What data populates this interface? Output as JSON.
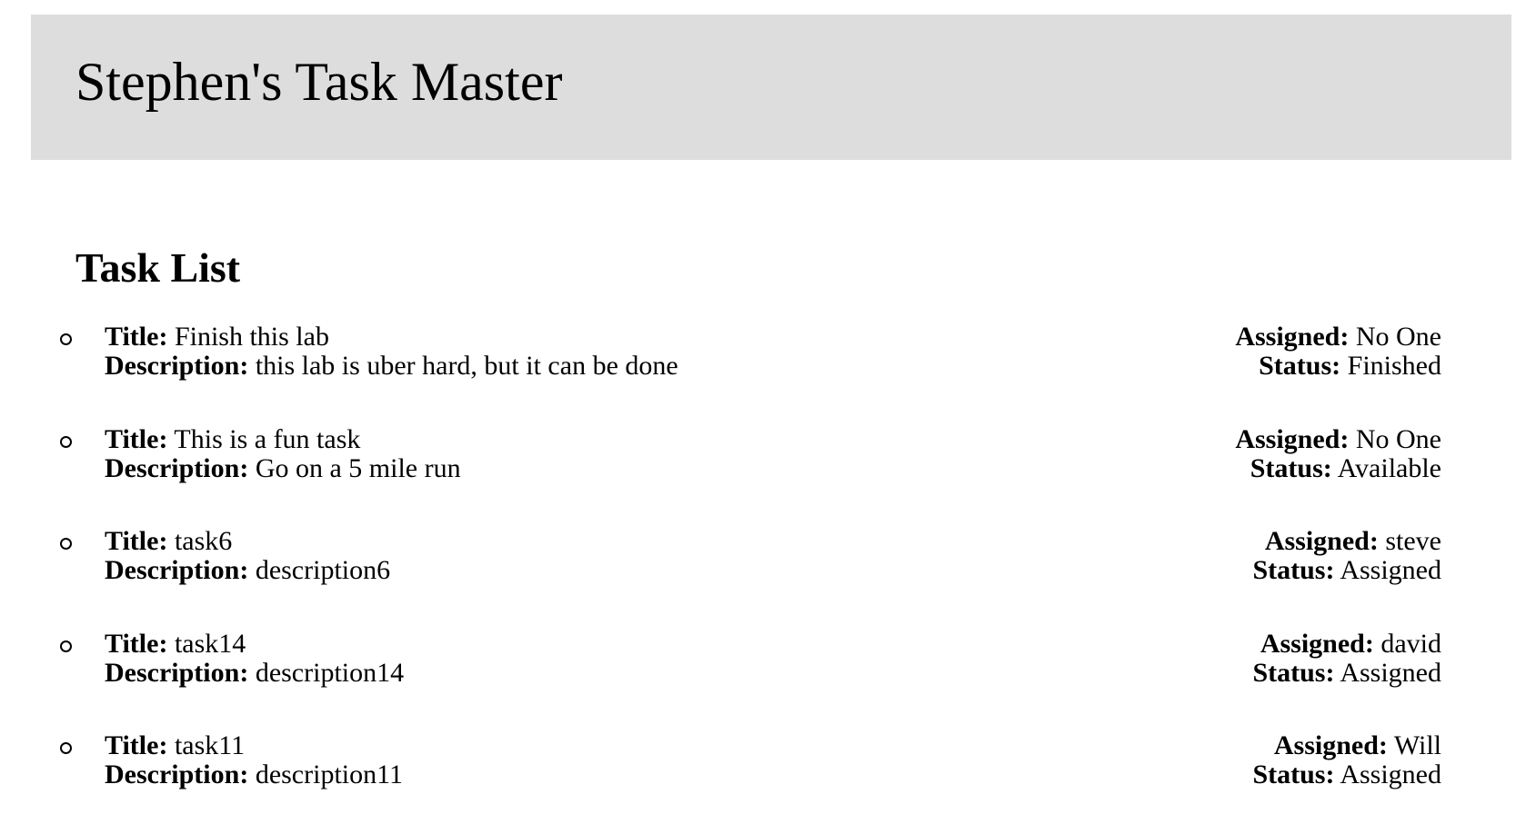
{
  "header": {
    "title": "Stephen's Task Master",
    "background": "#dddddd"
  },
  "task_list": {
    "heading": "Task List",
    "labels": {
      "title": "Title:",
      "description": "Description:",
      "assigned": "Assigned:",
      "status": "Status:"
    },
    "items": [
      {
        "title": "Finish this lab",
        "description": "this lab is uber hard, but it can be done",
        "assigned": "No One",
        "status": "Finished"
      },
      {
        "title": "This is a fun task",
        "description": "Go on a 5 mile run",
        "assigned": "No One",
        "status": "Available"
      },
      {
        "title": "task6",
        "description": "description6",
        "assigned": "steve",
        "status": "Assigned"
      },
      {
        "title": "task14",
        "description": "description14",
        "assigned": "david",
        "status": "Assigned"
      },
      {
        "title": "task11",
        "description": "description11",
        "assigned": "Will",
        "status": "Assigned"
      }
    ]
  }
}
